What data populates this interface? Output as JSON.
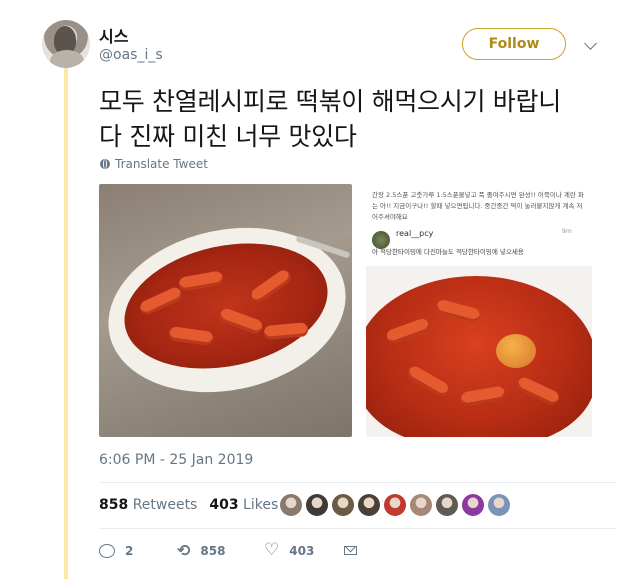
{
  "user": {
    "display_name": "시스",
    "handle": "@oas_i_s"
  },
  "follow_label": "Follow",
  "tweet": {
    "text_line1": "모두 찬열레시피로 떡볶이 해먹으시기 바랍니",
    "text_line2": "다 진짜 미친 너무 맛있다",
    "translate_label": "Translate Tweet"
  },
  "embedded_post": {
    "caption": "간장 2.5스푼 고춧가루 1.5스푼물넣고 푹 졸여주시면 완성!! 어묵이나 계란 파는 아!! 지금이구나!! 할때 넣으면됩니다. 중간중간 떡이 눌러붙지않게 계속 저어주셔야해요",
    "comment_user": "real__pcy",
    "comment_time": "9m",
    "comment_text": "아 적당한타이밍에 다진마늘도 적당한타이밍에 넣으세용"
  },
  "timestamp": "6:06 PM - 25 Jan 2019",
  "stats": {
    "retweets_count": "858",
    "retweets_label": "Retweets",
    "likes_count": "403",
    "likes_label": "Likes"
  },
  "likers": [
    "#8a7a6e",
    "#3f3a36",
    "#6b5a44",
    "#4a4038",
    "#c23a2e",
    "#a48a76",
    "#5e5a56",
    "#8b3aa0",
    "#7a94b8"
  ],
  "actions": {
    "reply_count": "2",
    "retweet_count": "858",
    "like_count": "403"
  },
  "colors": {
    "follow_accent": "#c9a227",
    "thread_bar": "#fbe8a6",
    "muted_text": "#657786"
  }
}
